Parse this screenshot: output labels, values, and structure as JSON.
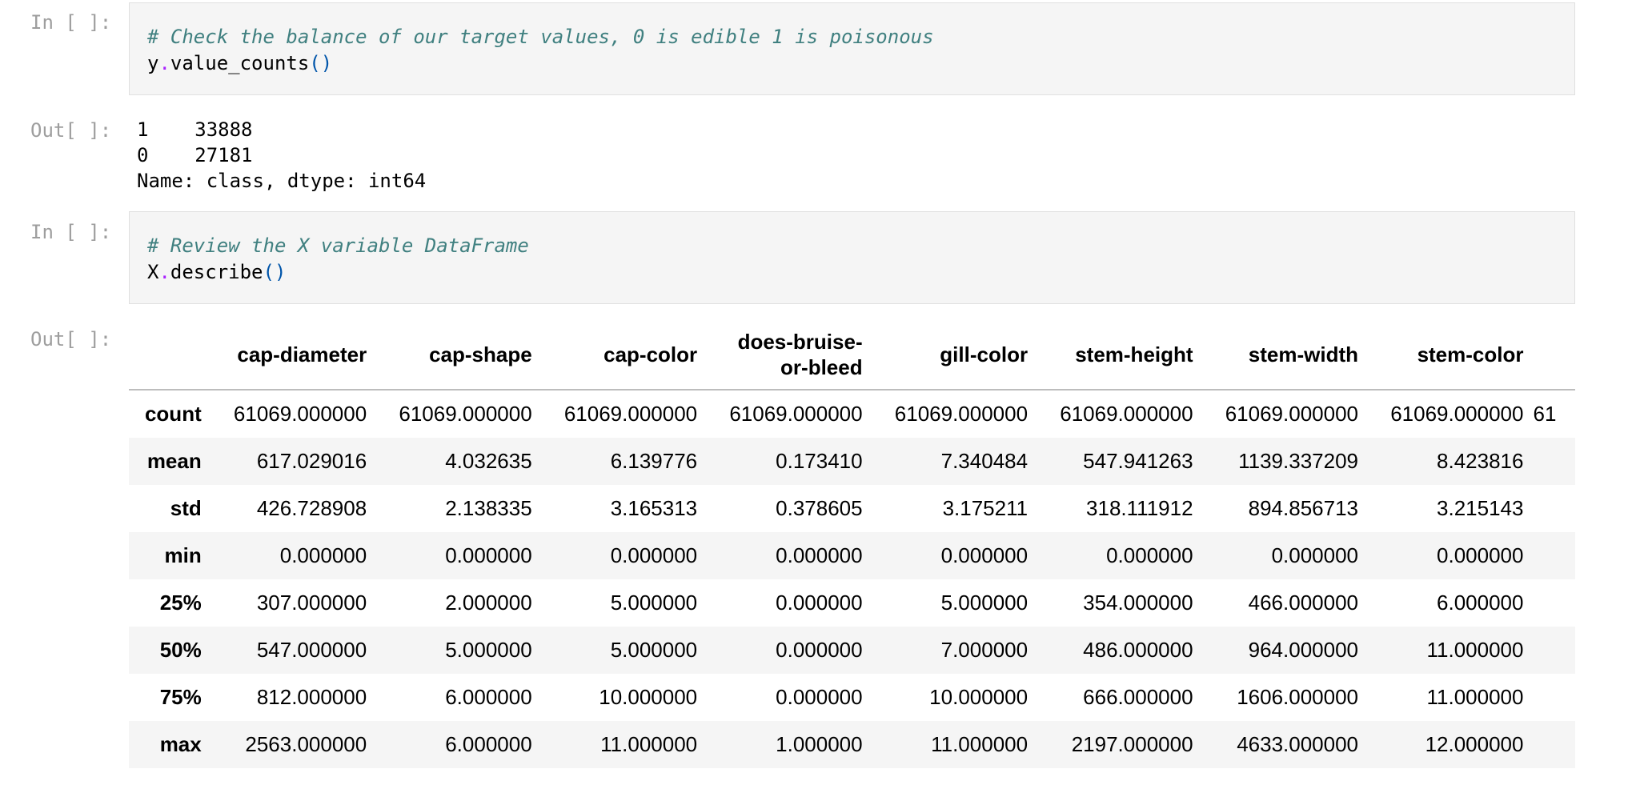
{
  "cells": [
    {
      "prompt": "In [ ]:",
      "comment": "# Check the balance of our target values, 0 is edible 1 is poisonous",
      "code_obj": "y",
      "code_dot": ".",
      "code_method": "value_counts",
      "code_parens": "()"
    },
    {
      "prompt": "Out[ ]:",
      "lines": [
        "1    33888",
        "0    27181",
        "Name: class, dtype: int64"
      ]
    },
    {
      "prompt": "In [ ]:",
      "comment": "# Review the X variable DataFrame",
      "code_obj": "X",
      "code_dot": ".",
      "code_method": "describe",
      "code_parens": "()"
    },
    {
      "prompt": "Out[ ]:"
    }
  ],
  "table": {
    "columns": [
      "cap-diameter",
      "cap-shape",
      "cap-color",
      "does-bruise-or-bleed",
      "gill-color",
      "stem-height",
      "stem-width",
      "stem-color",
      "61"
    ],
    "header_lines": [
      [
        "cap-diameter"
      ],
      [
        "cap-shape"
      ],
      [
        "cap-color"
      ],
      [
        "does-bruise-",
        "or-bleed"
      ],
      [
        "gill-color"
      ],
      [
        "stem-height"
      ],
      [
        "stem-width"
      ],
      [
        "stem-color"
      ],
      [
        ""
      ]
    ],
    "rows": [
      {
        "label": "count",
        "values": [
          "61069.000000",
          "61069.000000",
          "61069.000000",
          "61069.000000",
          "61069.000000",
          "61069.000000",
          "61069.000000",
          "61069.000000",
          "61"
        ]
      },
      {
        "label": "mean",
        "values": [
          "617.029016",
          "4.032635",
          "6.139776",
          "0.173410",
          "7.340484",
          "547.941263",
          "1139.337209",
          "8.423816",
          ""
        ]
      },
      {
        "label": "std",
        "values": [
          "426.728908",
          "2.138335",
          "3.165313",
          "0.378605",
          "3.175211",
          "318.111912",
          "894.856713",
          "3.215143",
          ""
        ]
      },
      {
        "label": "min",
        "values": [
          "0.000000",
          "0.000000",
          "0.000000",
          "0.000000",
          "0.000000",
          "0.000000",
          "0.000000",
          "0.000000",
          ""
        ]
      },
      {
        "label": "25%",
        "values": [
          "307.000000",
          "2.000000",
          "5.000000",
          "0.000000",
          "5.000000",
          "354.000000",
          "466.000000",
          "6.000000",
          ""
        ]
      },
      {
        "label": "50%",
        "values": [
          "547.000000",
          "5.000000",
          "5.000000",
          "0.000000",
          "7.000000",
          "486.000000",
          "964.000000",
          "11.000000",
          ""
        ]
      },
      {
        "label": "75%",
        "values": [
          "812.000000",
          "6.000000",
          "10.000000",
          "0.000000",
          "10.000000",
          "666.000000",
          "1606.000000",
          "11.000000",
          ""
        ]
      },
      {
        "label": "max",
        "values": [
          "2563.000000",
          "6.000000",
          "11.000000",
          "1.000000",
          "11.000000",
          "2197.000000",
          "4633.000000",
          "12.000000",
          ""
        ]
      }
    ]
  }
}
